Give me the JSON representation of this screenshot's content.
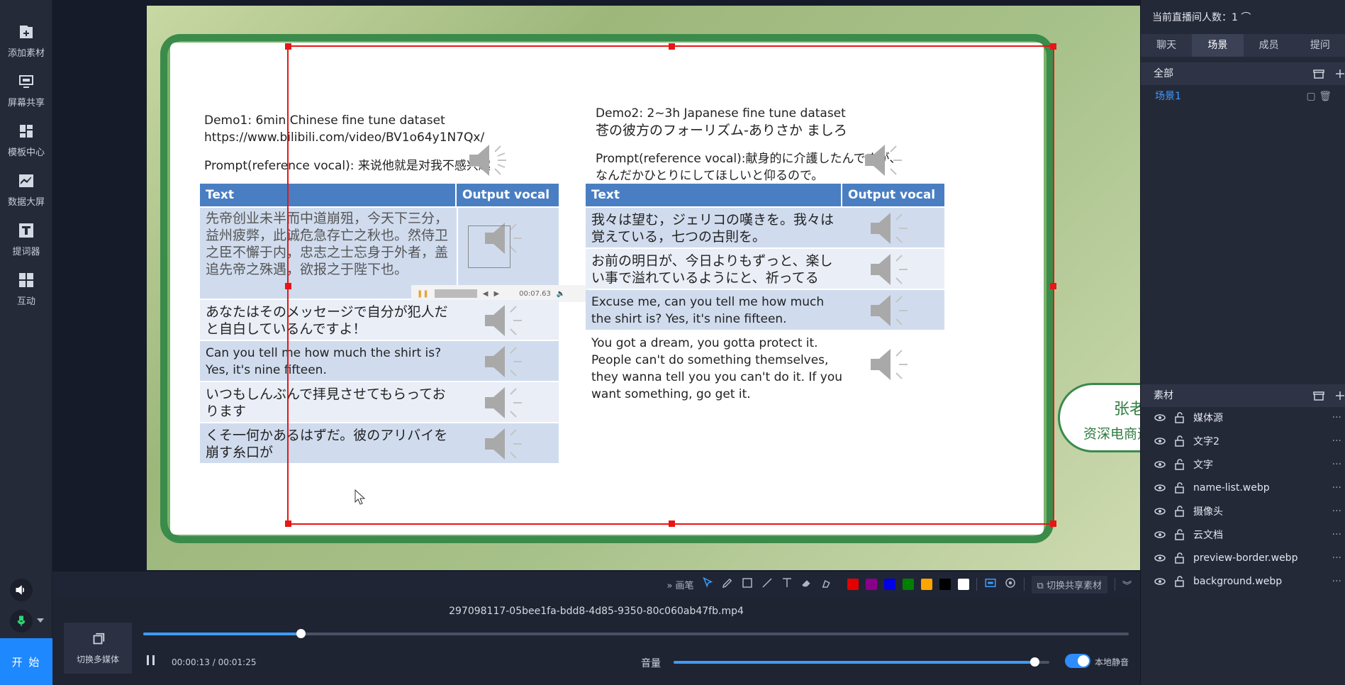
{
  "sidebar": {
    "items": [
      {
        "label": "添加素材",
        "icon": "add-material-icon"
      },
      {
        "label": "屏幕共享",
        "icon": "screen-share-icon"
      },
      {
        "label": "模板中心",
        "icon": "template-icon"
      },
      {
        "label": "数据大屏",
        "icon": "chart-icon"
      },
      {
        "label": "提词器",
        "icon": "teleprompter-icon"
      },
      {
        "label": "互动",
        "icon": "interact-icon"
      }
    ],
    "start_label": "开 始"
  },
  "slide": {
    "demo1_title": "Demo1: 6min Chinese fine tune dataset",
    "demo1_url": "https://www.bilibili.com/video/BV1o64y1N7Qx/",
    "demo1_prompt": "Prompt(reference vocal): 来说他就是对我不感兴趣",
    "demo2_title": "Demo2: 2~3h Japanese fine tune dataset",
    "demo2_subtitle": "苍の彼方のフォーリズム-ありさか ましろ",
    "demo2_prompt_line1": "Prompt(reference vocal):献身的に介護したんですが、",
    "demo2_prompt_line2": "なんだかひとりにしてほしいと仰るので。",
    "table_headers": {
      "text": "Text",
      "output": "Output vocal"
    },
    "left_rows": [
      "先帝创业未半而中道崩殂，今天下三分，益州疲弊，此诚危急存亡之秋也。然侍卫之臣不懈于内，忠志之士忘身于外者，盖追先帝之殊遇，欲报之于陛下也。",
      "あなたはそのメッセージで自分が犯人だと自白しているんですよ！",
      "Can you tell me how much the shirt is? Yes, it's nine fifteen.",
      "いつもしんぶんで拝見させてもらっております",
      "くそ一何かあるはずだ。彼のアリバイを崩す糸口が"
    ],
    "right_rows": [
      "我々は望む，ジェリコの嘆きを。我々は覚えている，七つの古則を。",
      "お前の明日が、今日よりもずっと、楽しい事で溢れているようにと、祈ってるよ。",
      "Excuse me, can you tell me how much the shirt is? Yes, it's nine fifteen.",
      "You got a dream, you gotta protect it. People can't do something themselves, they wanna tell you you can't do it. If you want something, go get it."
    ],
    "mini_player_time": "00:07.63",
    "name_card": {
      "name": "张老师",
      "title": "资深电商运营专家"
    }
  },
  "draw_toolbar": {
    "pen_label": "画笔",
    "colors": [
      "#e50000",
      "#8a008a",
      "#0000e6",
      "#008000",
      "#ffa500",
      "#000000",
      "#ffffff"
    ],
    "share_label": "切换共享素材"
  },
  "player": {
    "file_name": "297098117-05bee1fa-bdd8-4d85-9350-80c060ab47fb.mp4",
    "switch_label": "切换多媒体",
    "current": "00:00:13",
    "total": "00:01:25",
    "time_text": "00:00:13 / 00:01:25",
    "progress": 0.16,
    "volume_label": "音量",
    "volume": 0.96,
    "local_mute_label": "本地静音"
  },
  "right_panel": {
    "viewers_text": "当前直播间人数：1",
    "tabs": [
      "聊天",
      "场景",
      "成员",
      "提问"
    ],
    "active_tab": "场景",
    "scenes_header": "全部",
    "scenes": [
      "场景1"
    ],
    "materials_header": "素材",
    "materials": [
      "媒体源",
      "文字2",
      "文字",
      "name-list.webp",
      "摄像头",
      "云文档",
      "preview-border.webp",
      "background.webp"
    ]
  }
}
